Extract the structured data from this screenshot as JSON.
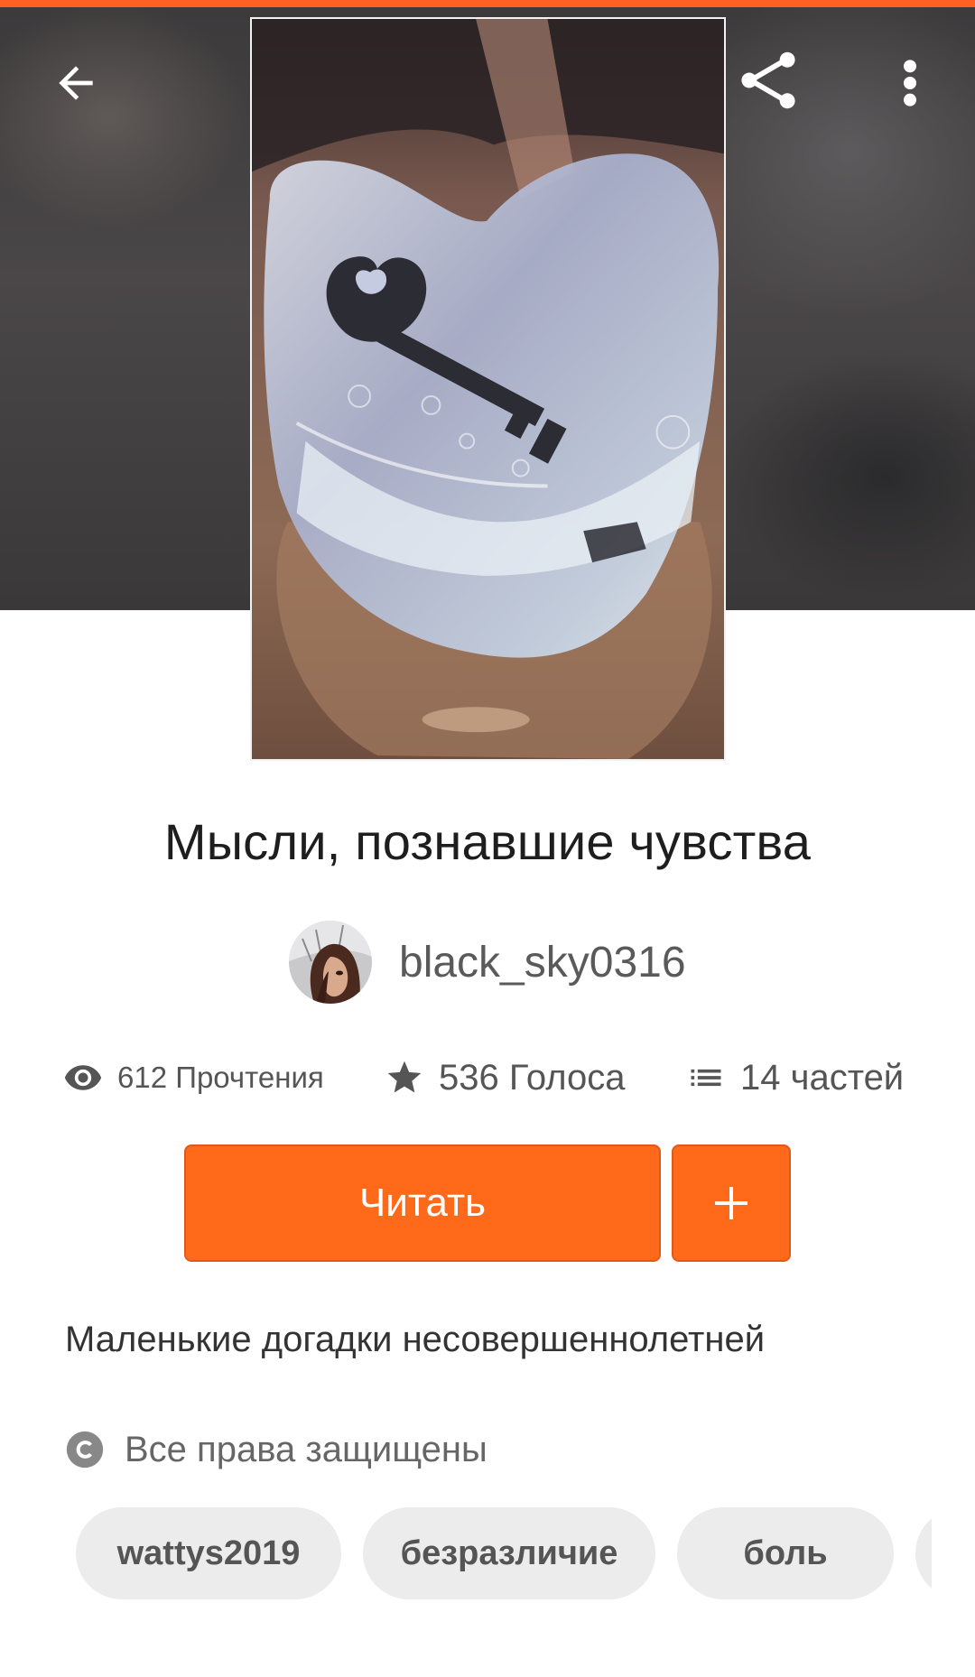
{
  "story": {
    "title": "Мысли, познавшие чувства",
    "author": "black_sky0316",
    "description": "Маленькие догадки несовершеннолетней",
    "license": "Все права защищены"
  },
  "stats": {
    "reads": "612 Прочтения",
    "votes": "536 Голоса",
    "parts": "14 частей"
  },
  "actions": {
    "read_label": "Читать",
    "add_label": "+"
  },
  "tags": [
    "wattys2019",
    "безразличие",
    "боль",
    ""
  ],
  "icons": [
    "back-arrow-icon",
    "share-icon",
    "more-vert-icon",
    "eye-icon",
    "star-icon",
    "list-icon",
    "copyright-icon"
  ],
  "colors": {
    "accent": "#ff6a1a",
    "tag_bg": "#ececec"
  }
}
